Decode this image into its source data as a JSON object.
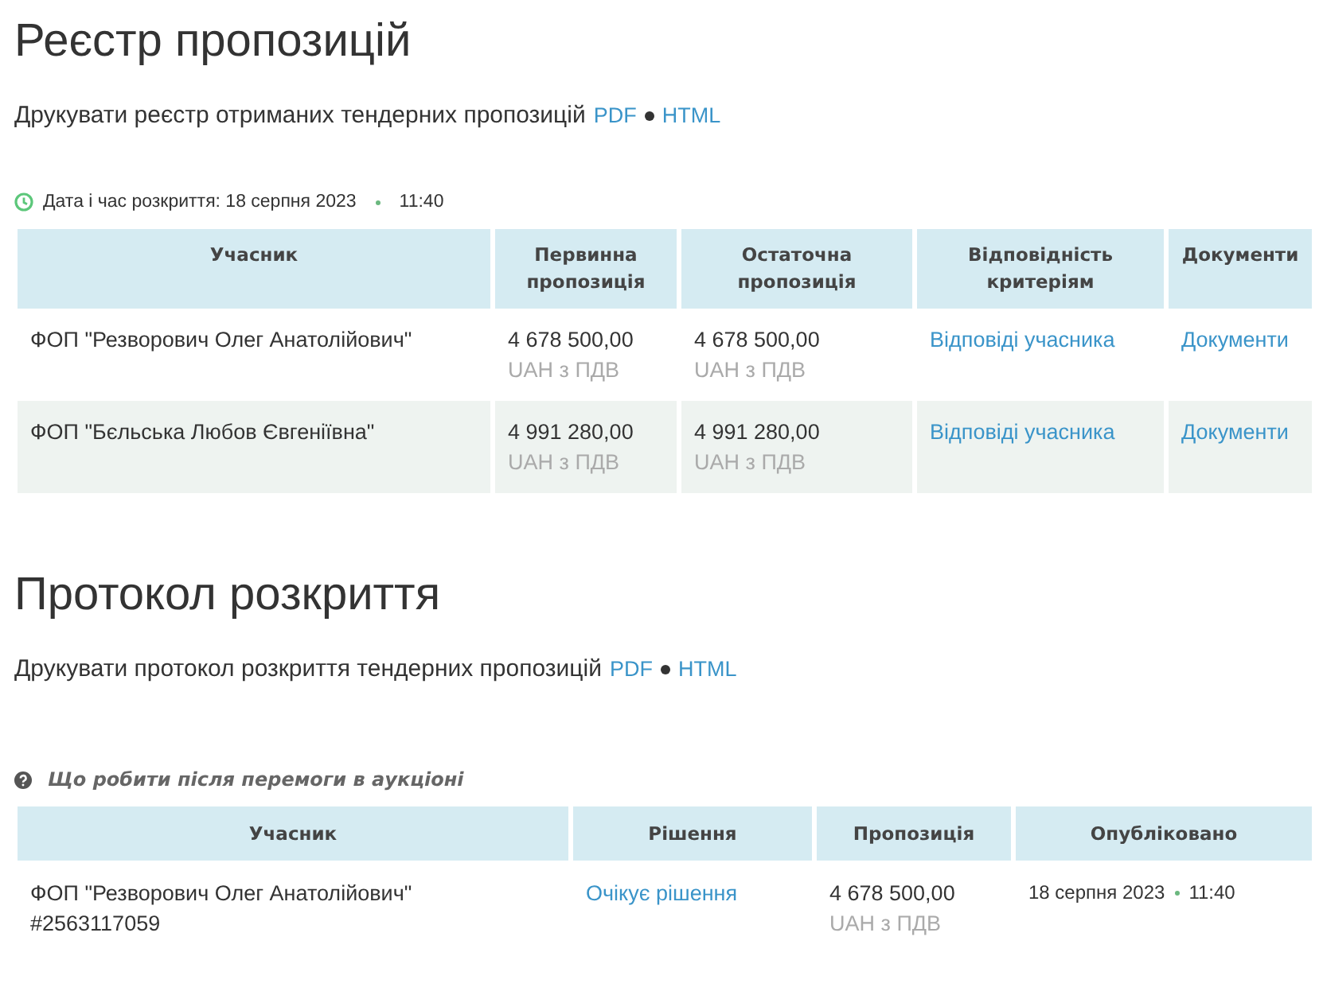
{
  "registry": {
    "title": "Реєстр пропозицій",
    "print_text": "Друкувати реєстр отриманих тендерних пропозицій",
    "print_links": [
      "PDF",
      "HTML"
    ],
    "opening": {
      "label": "Дата і час розкриття: 18 серпня 2023",
      "time": "11:40"
    },
    "columns": [
      "Учасник",
      "Первинна пропозиція",
      "Остаточна пропозиція",
      "Відповідність критеріям",
      "Документи"
    ],
    "rows": [
      {
        "participant": "ФОП \"Резворович Олег Анатолійович\"",
        "initial": "4 678 500,00",
        "initial_note": "UAH з ПДВ",
        "final": "4 678 500,00",
        "final_note": "UAH з ПДВ",
        "answers": "Відповіді учасника",
        "documents": "Документи"
      },
      {
        "participant": "ФОП \"Бєльська Любов Євгеніївна\"",
        "initial": "4 991 280,00",
        "initial_note": "UAH з ПДВ",
        "final": "4 991 280,00",
        "final_note": "UAH з ПДВ",
        "answers": "Відповіді учасника",
        "documents": "Документи"
      }
    ]
  },
  "protocol": {
    "title": "Протокол розкриття",
    "print_text": "Друкувати протокол розкриття тендерних пропозицій",
    "print_links": [
      "PDF",
      "HTML"
    ],
    "help": "Що робити після перемоги в аукціоні",
    "columns": [
      "Учасник",
      "Рішення",
      "Пропозиція",
      "Опубліковано"
    ],
    "rows": [
      {
        "participant": "ФОП \"Резворович Олег Анатолійович\"",
        "id": "#2563117059",
        "decision": "Очікує рішення",
        "offer": "4 678 500,00",
        "offer_note": "UAH з ПДВ",
        "date": "18 серпня 2023",
        "time": "11:40"
      }
    ]
  }
}
